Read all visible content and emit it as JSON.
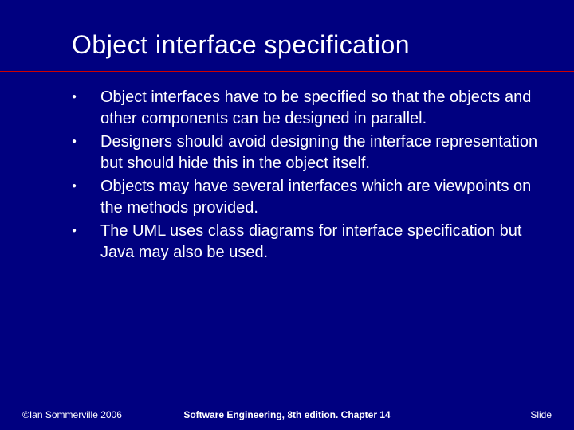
{
  "title": "Object interface specification",
  "bullets": [
    "Object interfaces have to be specified so that the objects and other components can be designed in parallel.",
    "Designers should avoid designing the interface representation but should hide this in the object itself.",
    "Objects may have several interfaces which are viewpoints on the methods provided.",
    "The UML uses class diagrams for interface specification but Java may also be used."
  ],
  "footer": {
    "left": "©Ian Sommerville 2006",
    "center": "Software Engineering, 8th edition. Chapter 14",
    "right": "Slide"
  }
}
